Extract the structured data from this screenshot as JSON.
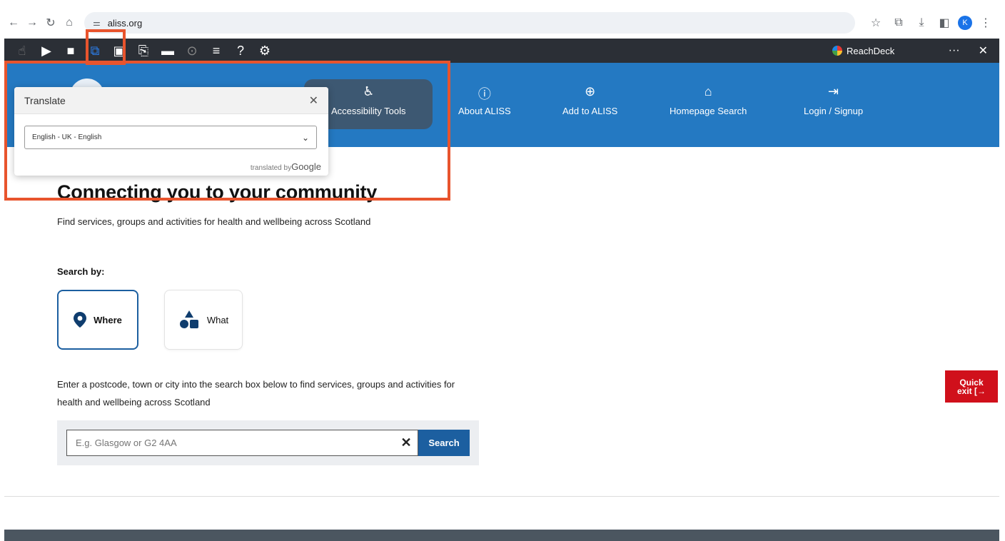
{
  "browser": {
    "url": "aliss.org",
    "avatar_initial": "K"
  },
  "reachdeck": {
    "brand": "ReachDeck",
    "more": "···",
    "close": "✕",
    "tools": [
      {
        "name": "hand-icon",
        "glyph": "☝"
      },
      {
        "name": "play-icon",
        "glyph": "▶"
      },
      {
        "name": "stop-icon",
        "glyph": "■"
      },
      {
        "name": "translate-icon",
        "glyph": "⧉"
      },
      {
        "name": "picture-dictionary-icon",
        "glyph": "▣"
      },
      {
        "name": "text-to-mp3-icon",
        "glyph": "⎘"
      },
      {
        "name": "screen-mask-icon",
        "glyph": "▬"
      },
      {
        "name": "magnifier-icon",
        "glyph": "⊙"
      },
      {
        "name": "simplify-icon",
        "glyph": "≡"
      },
      {
        "name": "help-icon",
        "glyph": "?"
      },
      {
        "name": "settings-icon",
        "glyph": "⚙"
      }
    ]
  },
  "nav": {
    "accessibility": "Accessibility Tools",
    "about": "About ALISS",
    "add": "Add to ALISS",
    "homepage": "Homepage Search",
    "login": "Login / Signup"
  },
  "translate_popup": {
    "title": "Translate",
    "selected_language": "English - UK - English",
    "credit_prefix": "translated by",
    "credit_brand": "Google"
  },
  "main": {
    "title": "Connecting you to your community",
    "subtitle": "Find services, groups and activities for health and wellbeing across Scotland",
    "search_by_label": "Search by:",
    "option_where": "Where",
    "option_what": "What",
    "description": "Enter a postcode, town or city into the search box below to find services, groups and activities for health and wellbeing across Scotland",
    "search_placeholder": "E.g. Glasgow or G2 4AA",
    "search_button": "Search"
  },
  "quick_exit": {
    "line1": "Quick",
    "line2": "exit [→"
  },
  "colors": {
    "header_blue": "#2479c2",
    "primary_blue": "#1c5fa0",
    "quick_exit_red": "#d0101b",
    "highlight_orange": "#e8542d"
  }
}
